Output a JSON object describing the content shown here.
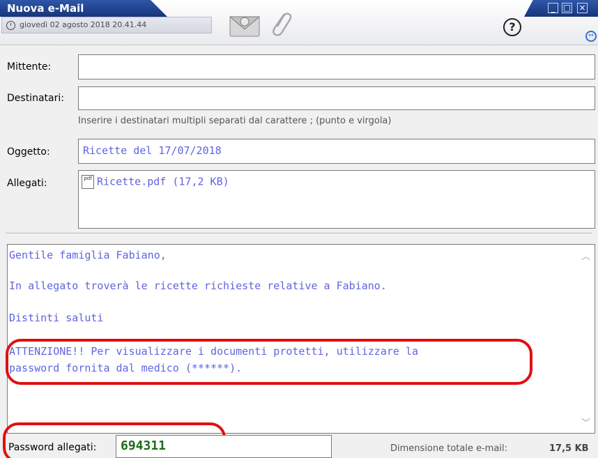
{
  "window": {
    "title": "Nuova e-Mail",
    "datetime": "giovedì 02 agosto 2018   20.41.44",
    "help_symbol": "?"
  },
  "icons": [
    "clock-icon",
    "envelope-icon",
    "paperclip-icon",
    "help-icon",
    "minimize-icon",
    "maximize-icon",
    "close-icon",
    "arrows-icon",
    "pdf-icon",
    "scroll-up-icon",
    "scroll-down-icon"
  ],
  "form": {
    "sender_label": "Mittente:",
    "sender_value": "",
    "recipients_label": "Destinatari:",
    "recipients_value": "",
    "recipients_hint": "Inserire i destinatari multipli separati dal carattere ; (punto e virgola)",
    "subject_label": "Oggetto:",
    "subject_value": "Ricette del 17/07/2018",
    "attachments_label": "Allegati:",
    "attachments": [
      {
        "icon_text": "pdf",
        "name": "Ricette.pdf (17,2 KB)"
      }
    ]
  },
  "body": {
    "lines": [
      "Gentile famiglia Fabiano,",
      "In allegato troverà le ricette richieste relative a Fabiano.",
      "Distinti saluti",
      "ATTENZIONE!! Per visualizzare i documenti protetti, utilizzare la",
      "password fornita dal medico (******)."
    ]
  },
  "footer": {
    "password_label": "Password allegati:",
    "password_value": "694311",
    "total_size_label": "Dimensione totale e-mail:",
    "total_size_value": "17,5 KB"
  },
  "colors": {
    "title_bar": "#1f4391",
    "body_text": "#5f64e0",
    "password_text": "#1a6b1a",
    "highlight_marks": "#e01010"
  }
}
